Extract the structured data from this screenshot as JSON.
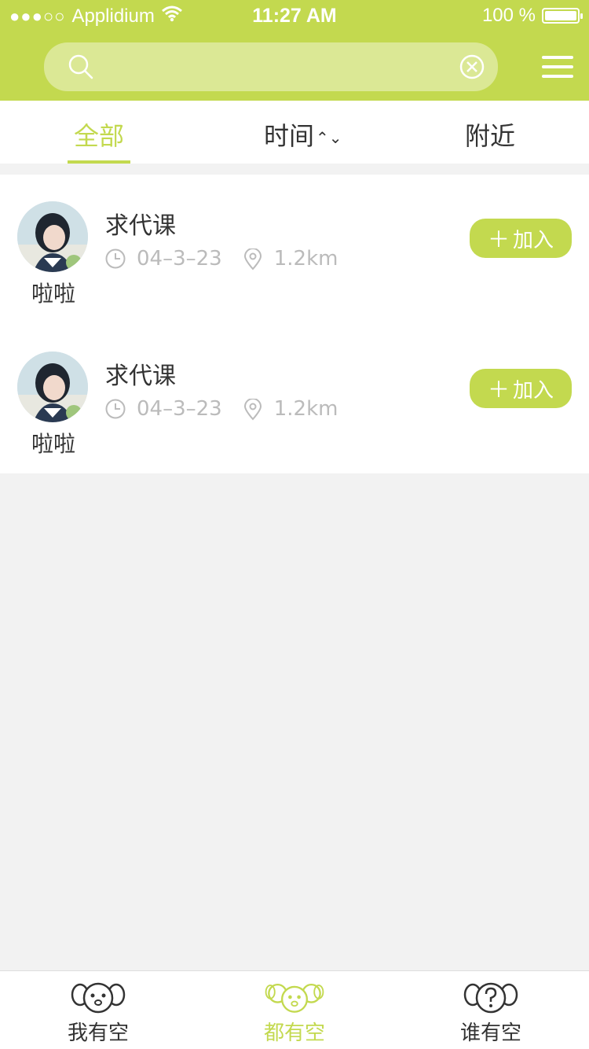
{
  "status_bar": {
    "signal": "●●●○○",
    "carrier": "Applidium",
    "time": "11:27 AM",
    "battery_text": "100 %"
  },
  "search": {
    "placeholder": "",
    "value": ""
  },
  "tabs": [
    {
      "label": "全部",
      "active": true
    },
    {
      "label": "时间",
      "active": false
    },
    {
      "label": "附近",
      "active": false
    }
  ],
  "list": {
    "items": [
      {
        "name": "啦啦",
        "title": "求代课",
        "date": "04–3–23",
        "distance": "1.2km",
        "button": "加入"
      },
      {
        "name": "啦啦",
        "title": "求代课",
        "date": "04–3–23",
        "distance": "1.2km",
        "button": "加入"
      }
    ]
  },
  "tabbar": {
    "items": [
      {
        "label": "我有空",
        "active": false
      },
      {
        "label": "都有空",
        "active": true
      },
      {
        "label": "谁有空",
        "active": false
      }
    ]
  },
  "colors": {
    "accent": "#c3d94f",
    "text": "#333333",
    "secondary": "#bbbbbb"
  }
}
